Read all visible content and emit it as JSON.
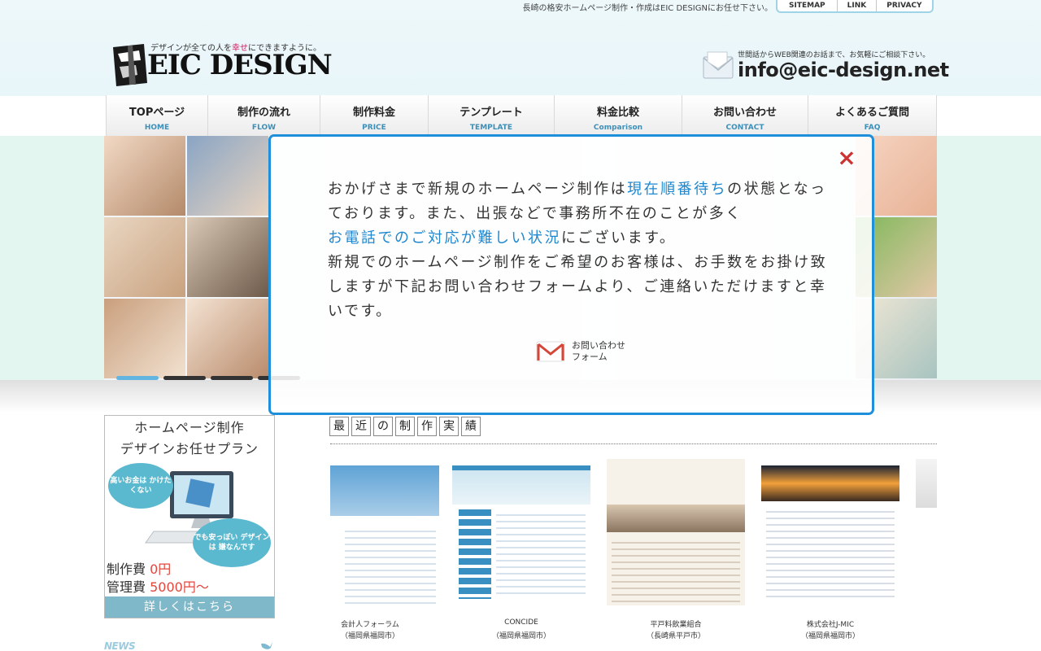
{
  "header": {
    "tagline": "長崎の格安ホームページ制作・作成はEIC DESIGNにお任せ下さい。",
    "util_nav": [
      "SITEMAP",
      "LINK",
      "PRIVACY"
    ],
    "logo_sub_before": "デザインが全ての人を",
    "logo_sub_pink": "幸せ",
    "logo_sub_after": "にできますように。",
    "logo_text": "EIC DESIGN",
    "contact_note": "世間話からWEB関連のお話まで、お気軽にご相談下さい。",
    "contact_email": "info@eic-design.net"
  },
  "nav": [
    {
      "ja": "TOPページ",
      "en": "HOME"
    },
    {
      "ja": "制作の流れ",
      "en": "FLOW"
    },
    {
      "ja": "制作料金",
      "en": "PRICE"
    },
    {
      "ja": "テンプレート",
      "en": "TEMPLATE"
    },
    {
      "ja": "料金比較",
      "en": "Comparison"
    },
    {
      "ja": "お問い合わせ",
      "en": "CONTACT"
    },
    {
      "ja": "よくあるご質問",
      "en": "FAQ"
    }
  ],
  "modal": {
    "close": "×",
    "text_1": "おかげさまで新規のホームページ制作は",
    "text_2": "現在順番待ち",
    "text_3": "の状態となっております。また、出張などで事務所不在のことが多く",
    "text_4": "お電話でのご対応が難しい状況",
    "text_5": "にございます。",
    "text_6": "新規でのホームページ制作をご希望のお客様は、お手数をお掛け致しますが下記お問い合わせフォームより、ご連絡いただけますと幸いです。",
    "cta_line1": "お問い合わせ",
    "cta_line2": "フォーム"
  },
  "slider": {
    "active_index": 0,
    "count": 4
  },
  "side_banner": {
    "title_1": "ホームページ制作",
    "title_2": "デザインお任せプラン",
    "bubble_1": "高いお金は かけたくない",
    "bubble_2": "でも安っぽい デザインは 嫌なんです",
    "price_1_label": "制作費",
    "price_1_value": "0円",
    "price_2_label": "管理費",
    "price_2_value": "5000円～",
    "button": "詳しくはこちら"
  },
  "news": {
    "heading": "NEWS"
  },
  "works": {
    "title_chars": [
      "最",
      "近",
      "の",
      "制",
      "作",
      "実",
      "績"
    ],
    "items": [
      {
        "name": "会計人フォーラム",
        "location": "（福岡県福岡市）"
      },
      {
        "name": "CONCIDE",
        "location": "（福岡県福岡市）"
      },
      {
        "name": "平戸料飲業組合",
        "location": "（長崎県平戸市）"
      },
      {
        "name": "株式会社J-MIC",
        "location": "（福岡県福岡市）"
      }
    ]
  },
  "colors": {
    "accent": "#1e90db",
    "nav_en": "#3d8fb8",
    "close": "#cc3333",
    "banner_bubble": "#5bb9cf",
    "banner_button": "#7fb8c8",
    "hero_band": "#e3f6ef"
  }
}
